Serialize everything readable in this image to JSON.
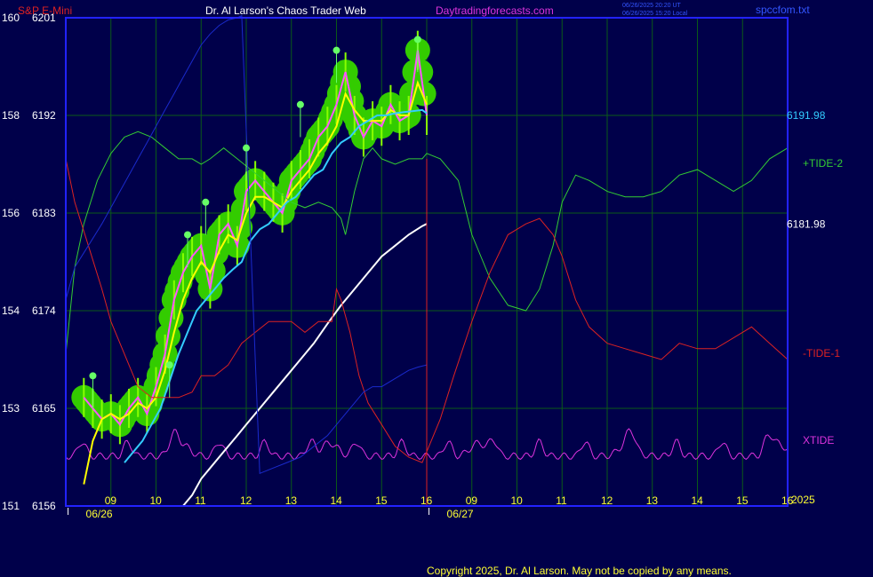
{
  "header": {
    "instrument": "S&P E-Mini",
    "site_title": "Dr. Al Larson's Chaos Trader Web",
    "site_url": "Daytradingforecasts.com",
    "timestamp_ut": "06/26/2025 20:20 UT",
    "timestamp_local": "06/26/2025 15:20 Local",
    "data_file": "spccfom.txt"
  },
  "footer": {
    "copyright": "Copyright 2025, Dr. Al Larson. May not be copied by any means."
  },
  "colors": {
    "background": "#00004a",
    "frame": "#2222ff",
    "grid": "#0b5a18",
    "price": "#ff55ff",
    "price_wick": "#88ff00",
    "ema_fast": "#ffff00",
    "ema_slow": "#33ccff",
    "ma_long": "#ffffff",
    "tide_plus2": "#33cc33",
    "tide_minus1": "#dd2222",
    "xtide": "#dd33dd",
    "blue_line": "#1a2acc",
    "signal_glow": "#33cc00",
    "signal_dot": "#66ff66"
  },
  "chart_data": {
    "type": "line",
    "title": "S&P E-Mini",
    "xlabel": "",
    "ylabel": "",
    "ylim": [
      6156,
      6201
    ],
    "y_ticks": [
      {
        "left": "160",
        "price": "6201"
      },
      {
        "left": "158",
        "price": "6192"
      },
      {
        "left": "156",
        "price": "6183"
      },
      {
        "left": "154",
        "price": "6174"
      },
      {
        "left": "153",
        "price": "6165"
      },
      {
        "left": "151",
        "price": "6156"
      }
    ],
    "x_ticks": [
      "09",
      "10",
      "11",
      "12",
      "13",
      "14",
      "15",
      "16",
      "09",
      "10",
      "11",
      "12",
      "13",
      "14",
      "15",
      "16"
    ],
    "date_labels": [
      "06/26",
      "06/27"
    ],
    "year_label": "2025",
    "grid": true,
    "right_labels": [
      {
        "text": "6191.98",
        "y": 6191.98,
        "color": "#33ccff"
      },
      {
        "text": "+TIDE-2",
        "y": 6188.5,
        "color": "#33cc33"
      },
      {
        "text": "6181.98",
        "y": 6181.98,
        "color": "#ffffff"
      },
      {
        "text": "-TIDE-1",
        "y": 6169,
        "color": "#dd2222"
      },
      {
        "text": "XTIDE",
        "y": 6161,
        "color": "#dd33dd"
      }
    ],
    "series": [
      {
        "color": "#ff55ff",
        "x": [
          8.4,
          8.6,
          8.8,
          9.0,
          9.2,
          9.4,
          9.6,
          9.8,
          10.0,
          10.2,
          10.4,
          10.6,
          10.8,
          11.0,
          11.2,
          11.4,
          11.6,
          11.8,
          12.0,
          12.2,
          12.4,
          12.6,
          12.8,
          13.0,
          13.2,
          13.4,
          13.6,
          13.8,
          14.0,
          14.2,
          14.4,
          14.6,
          14.8,
          15.0,
          15.2,
          15.4,
          15.6,
          15.8,
          16.0
        ],
        "y": [
          6166,
          6165,
          6164,
          6164.5,
          6163.5,
          6165,
          6166,
          6164.5,
          6167,
          6170,
          6175,
          6177.5,
          6179,
          6180,
          6176,
          6181,
          6182,
          6180,
          6185,
          6186,
          6185,
          6184,
          6183,
          6186,
          6187,
          6188,
          6190,
          6191,
          6193,
          6196,
          6192,
          6190,
          6191.5,
          6191,
          6193,
          6191.5,
          6192,
          6198,
          6192
        ]
      },
      {
        "color": "#ffff00",
        "x": [
          8.4,
          8.6,
          8.8,
          9.0,
          9.2,
          9.4,
          9.6,
          9.8,
          10.0,
          10.2,
          10.4,
          10.6,
          10.8,
          11.0,
          11.2,
          11.4,
          11.6,
          11.8,
          12.0,
          12.2,
          12.4,
          12.6,
          12.8,
          13.0,
          13.2,
          13.4,
          13.6,
          13.8,
          14.0,
          14.2,
          14.4,
          14.6,
          14.8,
          15.0,
          15.2,
          15.4,
          15.6,
          15.8,
          16.0
        ],
        "y": [
          6158,
          6162,
          6164,
          6164.5,
          6164,
          6164.5,
          6165.5,
          6165,
          6166,
          6168.5,
          6172,
          6175,
          6177,
          6178.5,
          6177.5,
          6179.5,
          6181,
          6180.5,
          6183,
          6184.5,
          6184.5,
          6184,
          6183.5,
          6185,
          6186,
          6187,
          6188.5,
          6189.5,
          6191,
          6194,
          6192.5,
          6191.5,
          6191.5,
          6191.5,
          6192.5,
          6192,
          6192,
          6195,
          6193
        ]
      },
      {
        "color": "#33ccff",
        "x": [
          9.3,
          9.5,
          9.7,
          9.9,
          10.1,
          10.3,
          10.5,
          10.7,
          10.9,
          11.1,
          11.3,
          11.5,
          11.7,
          11.9,
          12.1,
          12.3,
          12.5,
          12.7,
          12.9,
          13.1,
          13.3,
          13.5,
          13.7,
          13.9,
          14.1,
          14.3,
          14.5,
          14.7,
          14.9,
          15.1,
          15.3,
          15.5,
          15.7,
          15.9,
          16.0
        ],
        "y": [
          6160,
          6161,
          6162,
          6163.5,
          6165,
          6167.5,
          6170,
          6172,
          6174,
          6175,
          6176,
          6177,
          6177.8,
          6178.5,
          6180.5,
          6181.5,
          6182,
          6183,
          6184,
          6184.5,
          6185.5,
          6186.5,
          6187,
          6188.5,
          6189.5,
          6190,
          6191,
          6191.5,
          6192,
          6192,
          6192.2,
          6192.3,
          6192.4,
          6192.5,
          6192.2
        ]
      },
      {
        "color": "#ffffff",
        "x": [
          10.6,
          10.8,
          11.0,
          11.2,
          11.5,
          11.8,
          12.0,
          12.3,
          12.6,
          12.9,
          13.2,
          13.5,
          13.8,
          14.1,
          14.4,
          14.7,
          15.0,
          15.3,
          15.6,
          15.9,
          16.0
        ],
        "y": [
          6156,
          6157,
          6158.5,
          6159.5,
          6161,
          6162.5,
          6163.5,
          6165,
          6166.5,
          6168,
          6169.5,
          6171,
          6172.8,
          6174.5,
          6176,
          6177.5,
          6179,
          6180,
          6181,
          6181.8,
          6182
        ]
      },
      {
        "color": "#33cc33",
        "x": [
          8.0,
          8.2,
          8.4,
          8.7,
          9.0,
          9.3,
          9.6,
          9.9,
          10.2,
          10.5,
          10.8,
          11.0,
          11.2,
          11.5,
          11.8,
          12.1,
          12.4,
          12.7,
          13.0,
          13.3,
          13.6,
          13.9,
          14.0,
          14.1,
          14.2,
          14.4,
          14.6,
          14.8,
          15.0,
          15.3,
          15.6,
          15.9,
          16.0,
          16.3,
          16.7,
          17.0,
          17.4,
          17.8,
          18.2,
          18.5,
          18.8,
          19.0,
          19.3,
          19.6,
          20.0,
          20.4,
          20.8,
          21.2,
          21.6,
          22.0,
          22.4,
          22.8,
          23.2,
          23.6,
          24.0
        ],
        "y": [
          6170,
          6178,
          6182,
          6186,
          6188.5,
          6190,
          6190.5,
          6190,
          6189,
          6188,
          6188,
          6187.5,
          6188,
          6189,
          6188,
          6187,
          6186,
          6185,
          6184,
          6183.5,
          6184,
          6183.5,
          6183,
          6182.5,
          6181,
          6185,
          6188,
          6189,
          6188,
          6187.5,
          6188,
          6188,
          6188.5,
          6188,
          6186,
          6181,
          6177,
          6174.5,
          6174,
          6176,
          6180,
          6184,
          6186.5,
          6186,
          6185,
          6184.5,
          6184.5,
          6185,
          6186.5,
          6187,
          6186,
          6185,
          6186,
          6188,
          6189
        ]
      },
      {
        "color": "#dd2222",
        "x": [
          8.0,
          8.2,
          8.5,
          8.8,
          9.0,
          9.3,
          9.6,
          9.9,
          10.2,
          10.5,
          10.8,
          11.0,
          11.3,
          11.6,
          11.9,
          12.2,
          12.5,
          12.8,
          13.0,
          13.3,
          13.6,
          13.9,
          14.0,
          14.1,
          14.3,
          14.5,
          14.7,
          15.0,
          15.3,
          15.6,
          15.9,
          16.0,
          16.3,
          16.6,
          17.0,
          17.4,
          17.8,
          18.2,
          18.5,
          18.8,
          19.0,
          19.3,
          19.6,
          20.0,
          20.4,
          20.8,
          21.2,
          21.6,
          22.0,
          22.4,
          22.8,
          23.2,
          23.6,
          24.0
        ],
        "y": [
          6188,
          6184,
          6180,
          6176,
          6173,
          6170,
          6167,
          6166,
          6166,
          6166,
          6166.5,
          6168,
          6168,
          6169,
          6171,
          6172,
          6173,
          6173,
          6173,
          6172,
          6173,
          6173,
          6176,
          6175,
          6172,
          6168,
          6165.5,
          6163.5,
          6161.5,
          6160.5,
          6160,
          6161,
          6164,
          6168,
          6173,
          6177.5,
          6181,
          6182,
          6182.5,
          6181,
          6179,
          6175,
          6172.5,
          6171,
          6170.5,
          6170,
          6169.5,
          6171,
          6170.5,
          6170.5,
          6171.5,
          6172.5,
          6171,
          6169.5
        ]
      },
      {
        "color": "#1a2acc",
        "x": [
          8.0,
          8.2,
          8.5,
          8.8,
          9.0,
          9.2,
          9.4,
          9.6,
          9.8,
          10.0,
          10.2,
          10.4,
          10.6,
          10.8,
          11.0,
          11.2,
          11.4,
          11.6,
          11.8,
          11.9,
          12.3,
          12.6,
          12.9,
          13.2,
          13.5,
          13.8,
          14.1,
          14.4,
          14.6,
          14.8,
          15.0,
          15.2,
          15.4,
          15.6,
          15.8,
          16.0
        ],
        "y": [
          6175,
          6178,
          6180,
          6182,
          6183.5,
          6185,
          6186.5,
          6188,
          6189.5,
          6191,
          6192.5,
          6194,
          6195.5,
          6197,
          6198.5,
          6199.5,
          6200.3,
          6200.8,
          6201,
          6201.2,
          6159,
          6159.5,
          6160,
          6160.5,
          6161.5,
          6162.5,
          6164,
          6165.5,
          6166.5,
          6167,
          6167,
          6167.5,
          6168,
          6168.5,
          6168.8,
          6169
        ]
      }
    ]
  }
}
